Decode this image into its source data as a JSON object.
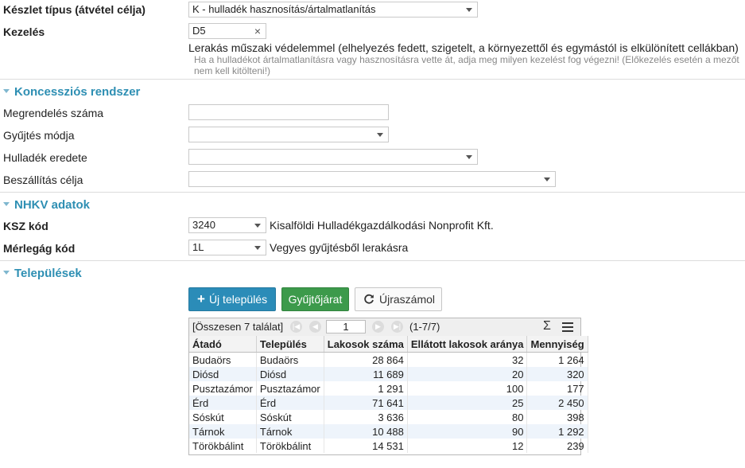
{
  "top": {
    "keszlet_label": "Készlet típus (átvétel célja)",
    "keszlet_value": "K - hulladék hasznosítás/ártalmatlanítás",
    "kezeles_label": "Kezelés",
    "kezeles_value": "D5",
    "kezeles_desc": "Lerakás műszaki védelemmel (elhelyezés fedett, szigetelt, a környezettől és egymástól is elkülönített cellákban)",
    "kezeles_hint": "Ha a hulladékot ártalmatlanításra vagy hasznosításra vette át, adja meg milyen kezelést fog végezni! (Előkezelés esetén a mezőt nem kell kitölteni!)"
  },
  "koncesszio": {
    "title": "Koncessziós rendszer",
    "megrendeles_label": "Megrendelés száma",
    "megrendeles_value": "",
    "gyujtes_label": "Gyűjtés módja",
    "gyujtes_value": "",
    "eredet_label": "Hulladék eredete",
    "eredet_value": "",
    "celja_label": "Beszállítás célja",
    "celja_value": ""
  },
  "nhkv": {
    "title": "NHKV adatok",
    "ksz_label": "KSZ kód",
    "ksz_value": "3240",
    "ksz_desc": "Kisalföldi Hulladékgazdálkodási Nonprofit Kft.",
    "merleg_label": "Mérlegág kód",
    "merleg_value": "1L",
    "merleg_desc": "Vegyes gyűjtésből lerakásra"
  },
  "telepulesek": {
    "title": "Települések",
    "btn_new": "Új település",
    "btn_gyujto": "Gyűjtőjárat",
    "btn_ujra": "Újraszámol",
    "total": "[Összesen 7 találat]",
    "page": "1",
    "range": "(1-7/7)",
    "columns": [
      "Átadó",
      "Település",
      "Lakosok száma",
      "Ellátott lakosok aránya",
      "Mennyiség"
    ],
    "rows": [
      [
        "Budaörs",
        "Budaörs",
        "28 864",
        "32",
        "1 264"
      ],
      [
        "Diósd",
        "Diósd",
        "11 689",
        "20",
        "320"
      ],
      [
        "Pusztazámor",
        "Pusztazámor",
        "1 291",
        "100",
        "177"
      ],
      [
        "Érd",
        "Érd",
        "71 641",
        "25",
        "2 450"
      ],
      [
        "Sóskút",
        "Sóskút",
        "3 636",
        "80",
        "398"
      ],
      [
        "Tárnok",
        "Tárnok",
        "10 488",
        "90",
        "1 292"
      ],
      [
        "Törökbálint",
        "Törökbálint",
        "14 531",
        "12",
        "239"
      ]
    ]
  },
  "colors": {
    "section": "#2e8fb3",
    "btn_new": "#2b8cb8",
    "btn_gyujto": "#3c9a4b"
  }
}
